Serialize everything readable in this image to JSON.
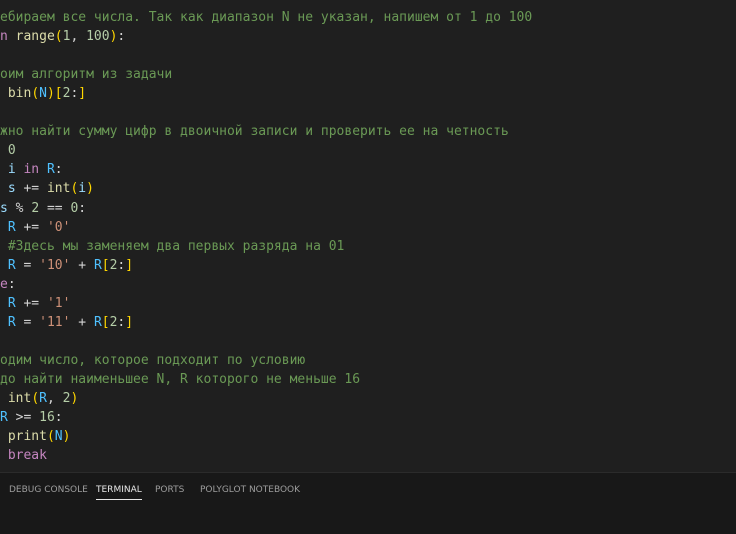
{
  "colors": {
    "editor_background": "#1f1f1f",
    "panel_background": "#181818",
    "comment": "#6a9955",
    "keyword": "#c586c0",
    "function": "#dcdcaa",
    "variable": "#9cdcfe",
    "constant": "#4fc1ff",
    "number": "#b5cea8",
    "string": "#ce9178",
    "bracket_gold": "#ffd700",
    "bracket_pink": "#da70d6",
    "default_text": "#d4d4d4"
  },
  "editor": {
    "lines": [
      [
        {
          "t": "ебираем все числа. Так как диапазон N не указан, напишем от 1 до 100",
          "c": "comment"
        }
      ],
      [
        {
          "t": "n",
          "c": "keyword"
        },
        {
          "t": " ",
          "c": "default_text"
        },
        {
          "t": "range",
          "c": "function"
        },
        {
          "t": "(",
          "c": "bracket_gold"
        },
        {
          "t": "1",
          "c": "number"
        },
        {
          "t": ", ",
          "c": "default_text"
        },
        {
          "t": "100",
          "c": "number"
        },
        {
          "t": ")",
          "c": "bracket_gold"
        },
        {
          "t": ":",
          "c": "default_text"
        }
      ],
      [],
      [
        {
          "t": "оим алгоритм из задачи",
          "c": "comment"
        }
      ],
      [
        {
          "t": " ",
          "c": "default_text"
        },
        {
          "t": "bin",
          "c": "function"
        },
        {
          "t": "(",
          "c": "bracket_gold"
        },
        {
          "t": "N",
          "c": "constant"
        },
        {
          "t": ")",
          "c": "bracket_gold"
        },
        {
          "t": "[",
          "c": "bracket_gold"
        },
        {
          "t": "2",
          "c": "number"
        },
        {
          "t": ":",
          "c": "default_text"
        },
        {
          "t": "]",
          "c": "bracket_gold"
        }
      ],
      [],
      [
        {
          "t": "жно найти сумму цифр в двоичной записи и проверить ее на четность",
          "c": "comment"
        }
      ],
      [
        {
          "t": " ",
          "c": "default_text"
        },
        {
          "t": "0",
          "c": "number"
        }
      ],
      [
        {
          "t": " ",
          "c": "default_text"
        },
        {
          "t": "i",
          "c": "variable"
        },
        {
          "t": " ",
          "c": "default_text"
        },
        {
          "t": "in",
          "c": "keyword"
        },
        {
          "t": " ",
          "c": "default_text"
        },
        {
          "t": "R",
          "c": "constant"
        },
        {
          "t": ":",
          "c": "default_text"
        }
      ],
      [
        {
          "t": " ",
          "c": "default_text"
        },
        {
          "t": "s",
          "c": "variable"
        },
        {
          "t": " += ",
          "c": "default_text"
        },
        {
          "t": "int",
          "c": "function"
        },
        {
          "t": "(",
          "c": "bracket_gold"
        },
        {
          "t": "i",
          "c": "variable"
        },
        {
          "t": ")",
          "c": "bracket_gold"
        }
      ],
      [
        {
          "t": "s",
          "c": "variable"
        },
        {
          "t": " % ",
          "c": "default_text"
        },
        {
          "t": "2",
          "c": "number"
        },
        {
          "t": " == ",
          "c": "default_text"
        },
        {
          "t": "0",
          "c": "number"
        },
        {
          "t": ":",
          "c": "default_text"
        }
      ],
      [
        {
          "t": " ",
          "c": "default_text"
        },
        {
          "t": "R",
          "c": "constant"
        },
        {
          "t": " += ",
          "c": "default_text"
        },
        {
          "t": "'0'",
          "c": "string"
        }
      ],
      [
        {
          "t": " ",
          "c": "default_text"
        },
        {
          "t": "#Здесь мы заменяем два первых разряда на 01",
          "c": "comment"
        }
      ],
      [
        {
          "t": " ",
          "c": "default_text"
        },
        {
          "t": "R",
          "c": "constant"
        },
        {
          "t": " = ",
          "c": "default_text"
        },
        {
          "t": "'10'",
          "c": "string"
        },
        {
          "t": " + ",
          "c": "default_text"
        },
        {
          "t": "R",
          "c": "constant"
        },
        {
          "t": "[",
          "c": "bracket_gold"
        },
        {
          "t": "2",
          "c": "number"
        },
        {
          "t": ":",
          "c": "default_text"
        },
        {
          "t": "]",
          "c": "bracket_gold"
        }
      ],
      [
        {
          "t": "e",
          "c": "keyword"
        },
        {
          "t": ":",
          "c": "default_text"
        }
      ],
      [
        {
          "t": " ",
          "c": "default_text"
        },
        {
          "t": "R",
          "c": "constant"
        },
        {
          "t": " += ",
          "c": "default_text"
        },
        {
          "t": "'1'",
          "c": "string"
        }
      ],
      [
        {
          "t": " ",
          "c": "default_text"
        },
        {
          "t": "R",
          "c": "constant"
        },
        {
          "t": " = ",
          "c": "default_text"
        },
        {
          "t": "'11'",
          "c": "string"
        },
        {
          "t": " + ",
          "c": "default_text"
        },
        {
          "t": "R",
          "c": "constant"
        },
        {
          "t": "[",
          "c": "bracket_gold"
        },
        {
          "t": "2",
          "c": "number"
        },
        {
          "t": ":",
          "c": "default_text"
        },
        {
          "t": "]",
          "c": "bracket_gold"
        }
      ],
      [],
      [
        {
          "t": "одим число, которое подходит по условию",
          "c": "comment"
        }
      ],
      [
        {
          "t": "до найти наименьшее N, R которого не меньше 16",
          "c": "comment"
        }
      ],
      [
        {
          "t": " ",
          "c": "default_text"
        },
        {
          "t": "int",
          "c": "function"
        },
        {
          "t": "(",
          "c": "bracket_gold"
        },
        {
          "t": "R",
          "c": "constant"
        },
        {
          "t": ", ",
          "c": "default_text"
        },
        {
          "t": "2",
          "c": "number"
        },
        {
          "t": ")",
          "c": "bracket_gold"
        }
      ],
      [
        {
          "t": "R",
          "c": "constant"
        },
        {
          "t": " >= ",
          "c": "default_text"
        },
        {
          "t": "16",
          "c": "number"
        },
        {
          "t": ":",
          "c": "default_text"
        }
      ],
      [
        {
          "t": " ",
          "c": "default_text"
        },
        {
          "t": "print",
          "c": "function"
        },
        {
          "t": "(",
          "c": "bracket_gold"
        },
        {
          "t": "N",
          "c": "constant"
        },
        {
          "t": ")",
          "c": "bracket_gold"
        }
      ],
      [
        {
          "t": " ",
          "c": "default_text"
        },
        {
          "t": "break",
          "c": "keyword"
        }
      ]
    ]
  },
  "panel": {
    "tabs": [
      {
        "label": "DEBUG CONSOLE",
        "active": false
      },
      {
        "label": "TERMINAL",
        "active": true
      },
      {
        "label": "PORTS",
        "active": false
      },
      {
        "label": "POLYGLOT NOTEBOOK",
        "active": false
      }
    ]
  }
}
